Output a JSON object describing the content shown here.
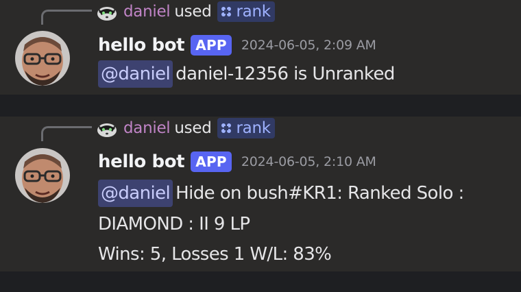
{
  "messages": [
    {
      "reply": {
        "user": "daniel",
        "used_text": "used",
        "command": "rank",
        "avatar_icon": "raccoon-avatar-icon"
      },
      "author": "hello bot",
      "badge": "APP",
      "timestamp": "2024-06-05, 2:09 AM",
      "mention": "@daniel",
      "lines": [
        "daniel-12356 is Unranked"
      ]
    },
    {
      "reply": {
        "user": "daniel",
        "used_text": "used",
        "command": "rank",
        "avatar_icon": "raccoon-avatar-icon"
      },
      "author": "hello bot",
      "badge": "APP",
      "timestamp": "2024-06-05, 2:10 AM",
      "mention": "@daniel",
      "lines": [
        "Hide on bush#KR1: Ranked Solo :",
        "DIAMOND : II 9 LP",
        "Wins: 5, Losses 1 W/L: 83%"
      ]
    }
  ],
  "colors": {
    "background": "#1e1f22",
    "message_bg": "#2b2a29",
    "reply_user": "#c084c6",
    "command": "#9fb2ff",
    "app_badge": "#5865f2",
    "mention_bg": "#3d4270",
    "mention_text": "#c9cdfb",
    "timestamp": "#9b9ca3"
  }
}
